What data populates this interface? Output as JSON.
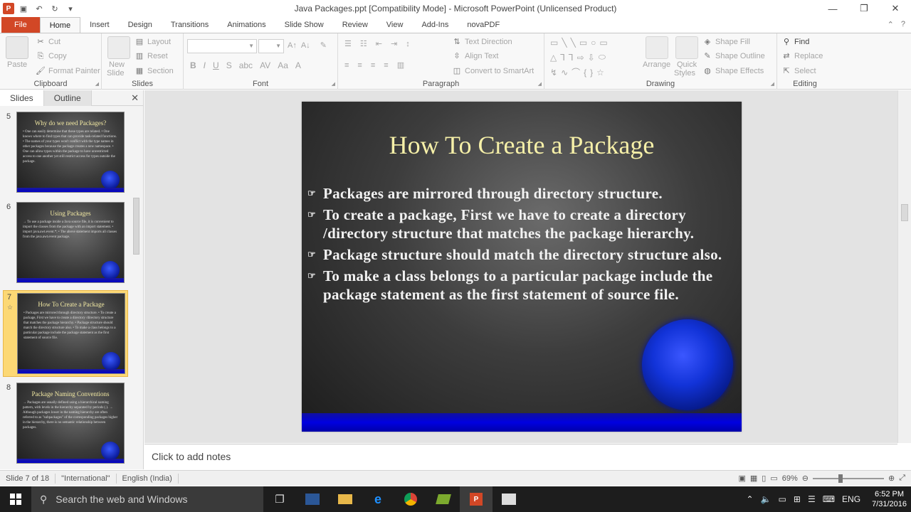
{
  "window": {
    "title": "Java Packages.ppt [Compatibility Mode] - Microsoft PowerPoint (Unlicensed Product)",
    "controls": [
      "—",
      "❐",
      "✕"
    ]
  },
  "tabs": [
    "File",
    "Home",
    "Insert",
    "Design",
    "Transitions",
    "Animations",
    "Slide Show",
    "Review",
    "View",
    "Add-Ins",
    "novaPDF"
  ],
  "ribbon": {
    "clipboard": {
      "label": "Clipboard",
      "paste": "Paste",
      "cut": "Cut",
      "copy": "Copy",
      "format_painter": "Format Painter"
    },
    "slides": {
      "label": "Slides",
      "new_slide_1": "New",
      "new_slide_2": "Slide",
      "layout": "Layout",
      "reset": "Reset",
      "section": "Section"
    },
    "font": {
      "label": "Font"
    },
    "paragraph": {
      "label": "Paragraph",
      "text_direction": "Text Direction",
      "align_text": "Align Text",
      "convert_smartart": "Convert to SmartArt"
    },
    "drawing": {
      "label": "Drawing",
      "arrange": "Arrange",
      "quick_styles_1": "Quick",
      "quick_styles_2": "Styles",
      "shape_fill": "Shape Fill",
      "shape_outline": "Shape Outline",
      "shape_effects": "Shape Effects"
    },
    "editing": {
      "label": "Editing",
      "find": "Find",
      "replace": "Replace",
      "select": "Select"
    }
  },
  "panel": {
    "tab_slides": "Slides",
    "tab_outline": "Outline",
    "thumbnails": [
      {
        "num": "5",
        "title": "Why do we need Packages?",
        "body": "• One can easily determine that these types are related. • One knows where to find types that can provide task-related functions. • The names of your types won't conflict with the type names in other packages because the package creates a new namespace. • One can allow types within the package to have unrestricted access to one another yet still restrict access for types outside the package."
      },
      {
        "num": "6",
        "title": "Using Packages",
        "body": "→ To use a package inside a Java source file, it is convenient to import the classes from the package with an import statement. • import java.awt.event.*; • The above statement imports all classes from the java.awt.event package."
      },
      {
        "num": "7",
        "title": "How To Create a Package",
        "body": "• Packages are mirrored through directory structure. • To create a package, First we have to create a directory /directory structure that matches the package hierarchy. • Package structure should match the directory structure also. • To make a class belongs to a particular package include the package statement as the first statement of source file."
      },
      {
        "num": "8",
        "title": "Package Naming Conventions",
        "body": "→ Packages are usually defined using a hierarchical naming pattern, with levels in the hierarchy separated by periods (.). → Although packages lower in the naming hierarchy are often referred to as \"subpackages\" of the corresponding packages higher in the hierarchy, there is no semantic relationship between packages."
      }
    ]
  },
  "slide": {
    "title": "How To Create a Package",
    "bullets": [
      "Packages are mirrored through directory structure.",
      "To create a package, First we have to create a directory /directory structure that matches the package hierarchy.",
      "Package structure should match the directory structure also.",
      "To make a class belongs to a particular package include the package statement as the first statement of source file."
    ]
  },
  "notes_placeholder": "Click to add notes",
  "status": {
    "slide": "Slide 7 of 18",
    "theme": "\"International\"",
    "language": "English (India)",
    "zoom": "69%"
  },
  "taskbar": {
    "search": "Search the web and Windows",
    "lang": "ENG",
    "time": "6:52 PM",
    "date": "7/31/2016"
  },
  "colors": {
    "file_tab": "#d24726",
    "slide_title": "#f6f0a8",
    "band": "#0000e0",
    "selected_thumb": "#fcd875"
  }
}
